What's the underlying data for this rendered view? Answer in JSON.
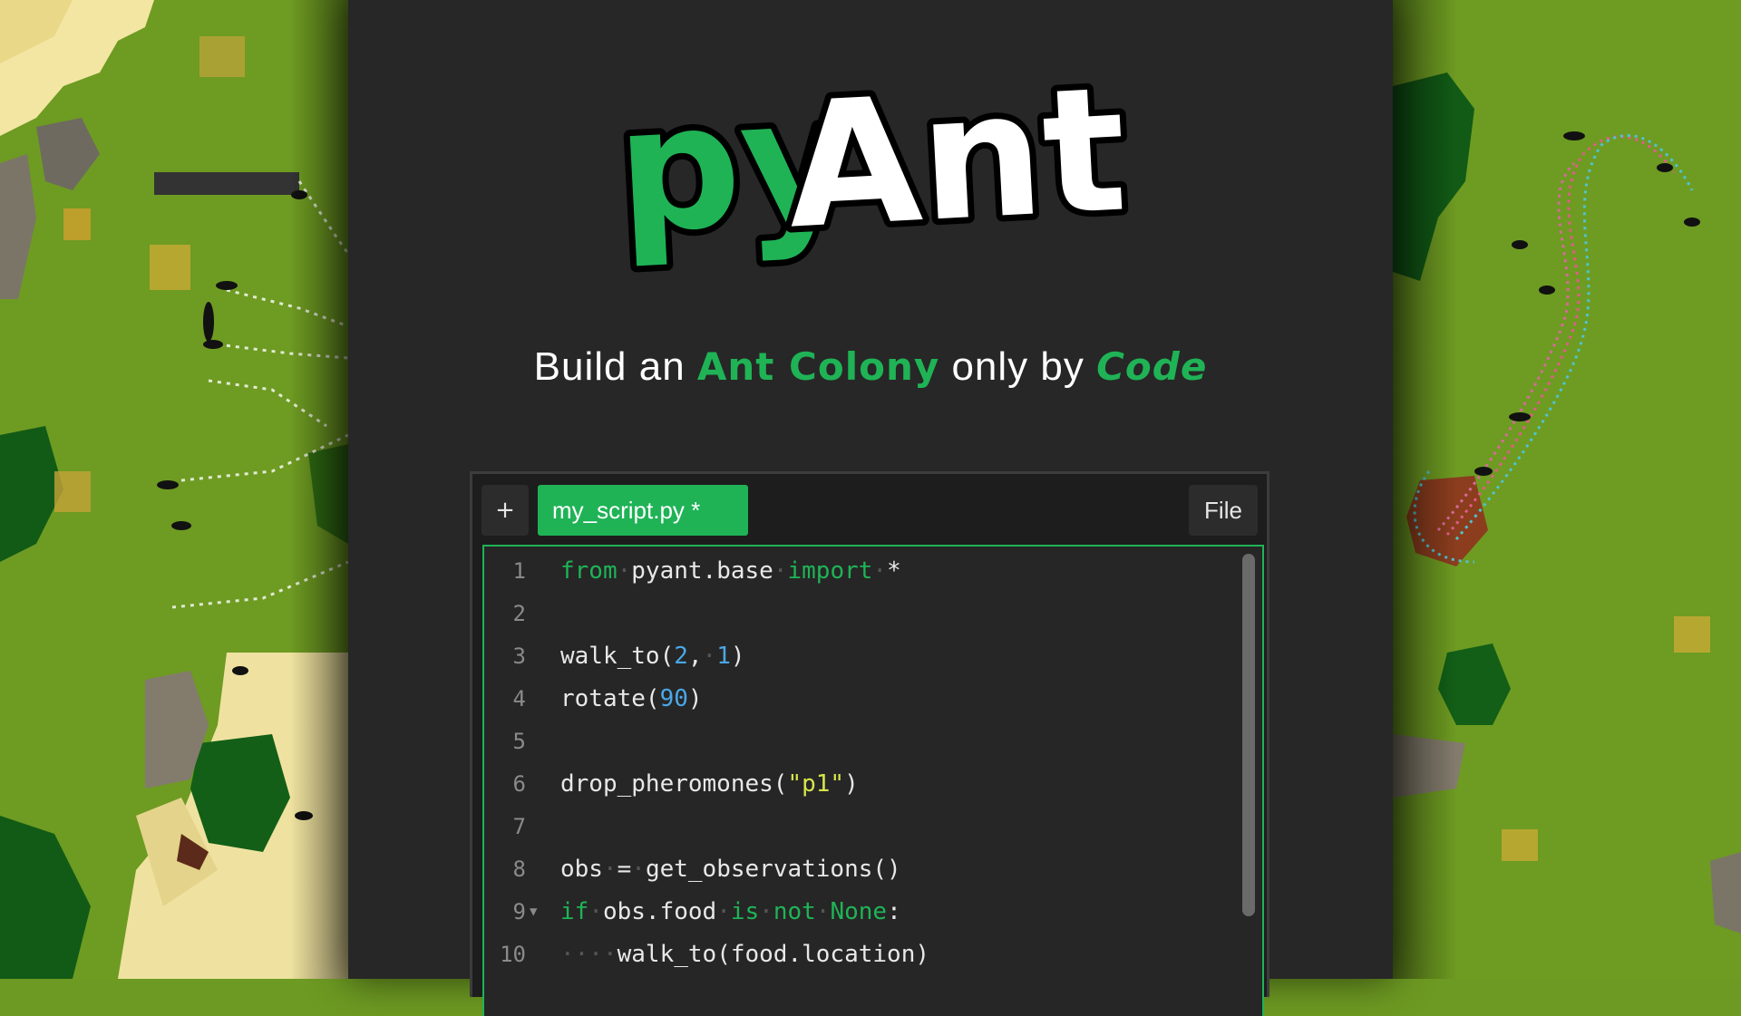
{
  "logo": {
    "part1": "py",
    "part2": "Ant"
  },
  "tagline": {
    "pre": "Build an ",
    "highlight1": "Ant Colony",
    "mid": " only by ",
    "highlight2": "Code"
  },
  "editor": {
    "add_tab_label": "+",
    "active_tab_label": "my_script.py *",
    "file_button_label": "File",
    "lines": [
      {
        "n": "1",
        "tokens": [
          {
            "c": "kw",
            "t": "from"
          },
          {
            "c": "ws",
            "t": "·"
          },
          {
            "c": "",
            "t": "pyant.base"
          },
          {
            "c": "ws",
            "t": "·"
          },
          {
            "c": "kw",
            "t": "import"
          },
          {
            "c": "ws",
            "t": "·"
          },
          {
            "c": "",
            "t": "*"
          }
        ]
      },
      {
        "n": "2",
        "tokens": []
      },
      {
        "n": "3",
        "tokens": [
          {
            "c": "",
            "t": "walk_to("
          },
          {
            "c": "num",
            "t": "2"
          },
          {
            "c": "",
            "t": ","
          },
          {
            "c": "ws",
            "t": "·"
          },
          {
            "c": "num",
            "t": "1"
          },
          {
            "c": "",
            "t": ")"
          }
        ]
      },
      {
        "n": "4",
        "tokens": [
          {
            "c": "",
            "t": "rotate("
          },
          {
            "c": "num",
            "t": "90"
          },
          {
            "c": "",
            "t": ")"
          }
        ]
      },
      {
        "n": "5",
        "tokens": []
      },
      {
        "n": "6",
        "tokens": [
          {
            "c": "",
            "t": "drop_pheromones("
          },
          {
            "c": "str",
            "t": "\"p1\""
          },
          {
            "c": "",
            "t": ")"
          }
        ]
      },
      {
        "n": "7",
        "tokens": []
      },
      {
        "n": "8",
        "tokens": [
          {
            "c": "",
            "t": "obs"
          },
          {
            "c": "ws",
            "t": "·"
          },
          {
            "c": "",
            "t": "="
          },
          {
            "c": "ws",
            "t": "·"
          },
          {
            "c": "",
            "t": "get_observations()"
          }
        ]
      },
      {
        "n": "9",
        "fold": true,
        "tokens": [
          {
            "c": "kw",
            "t": "if"
          },
          {
            "c": "ws",
            "t": "·"
          },
          {
            "c": "",
            "t": "obs.food"
          },
          {
            "c": "ws",
            "t": "·"
          },
          {
            "c": "kw",
            "t": "is"
          },
          {
            "c": "ws",
            "t": "·"
          },
          {
            "c": "kw",
            "t": "not"
          },
          {
            "c": "ws",
            "t": "·"
          },
          {
            "c": "kw",
            "t": "None"
          },
          {
            "c": "",
            "t": ":"
          }
        ]
      },
      {
        "n": "10",
        "tokens": [
          {
            "c": "ws",
            "t": "····"
          },
          {
            "c": "",
            "t": "walk_to(food.location)"
          }
        ]
      }
    ]
  },
  "colors": {
    "accent": "#1fb356",
    "panel": "#272727",
    "number": "#4aa8e8",
    "string": "#d6e64a"
  },
  "icons": {
    "fold": "triangle-down-icon"
  }
}
